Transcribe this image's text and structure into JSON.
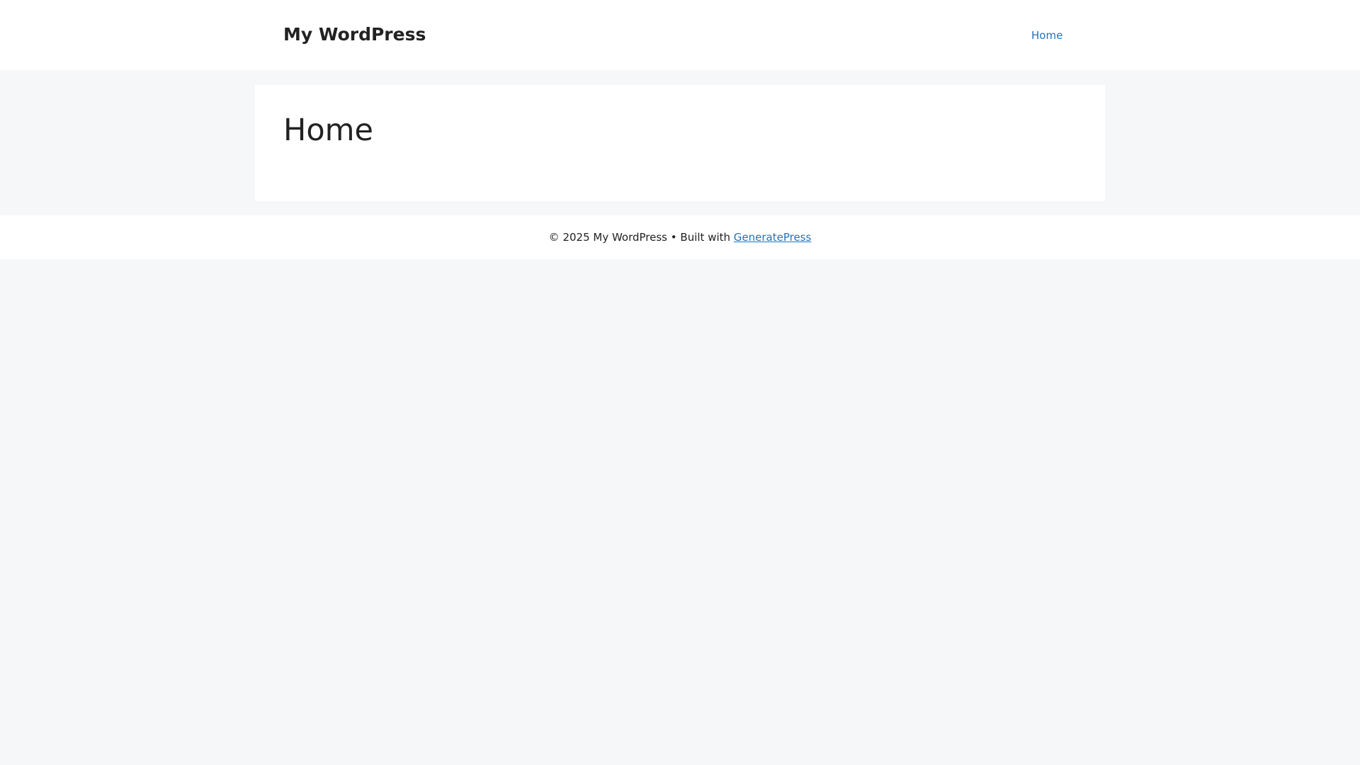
{
  "header": {
    "site_title": "My WordPress",
    "nav": [
      {
        "label": "Home"
      }
    ]
  },
  "main": {
    "page_title": "Home"
  },
  "footer": {
    "copyright": "© 2025 My WordPress",
    "separator": " • ",
    "built_with": "Built with ",
    "theme_link": "GeneratePress"
  },
  "colors": {
    "background": "#f6f7f9",
    "surface": "#ffffff",
    "text": "#222222",
    "link": "#1e73be"
  }
}
